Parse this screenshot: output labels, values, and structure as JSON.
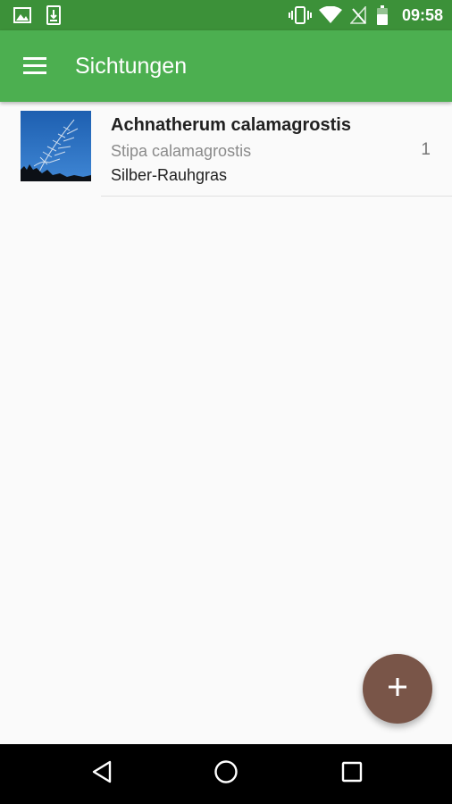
{
  "status_bar": {
    "time": "09:58",
    "icons": [
      "gallery-icon",
      "download-icon",
      "vibrate-icon",
      "wifi-icon",
      "no-signal-icon",
      "battery-icon"
    ]
  },
  "app_bar": {
    "title": "Sichtungen",
    "menu_icon": "hamburger-menu-icon",
    "color": "#4caf50",
    "status_color": "#3c9139"
  },
  "sightings": [
    {
      "title": "Achnatherum calamagrostis",
      "synonym": "Stipa calamagrostis",
      "common_name": "Silber-Rauhgras",
      "count": "1"
    }
  ],
  "fab": {
    "icon": "plus-icon",
    "color": "#795548"
  },
  "nav_bar": {
    "back_icon": "back-icon",
    "home_icon": "home-icon",
    "recents_icon": "recents-icon"
  }
}
